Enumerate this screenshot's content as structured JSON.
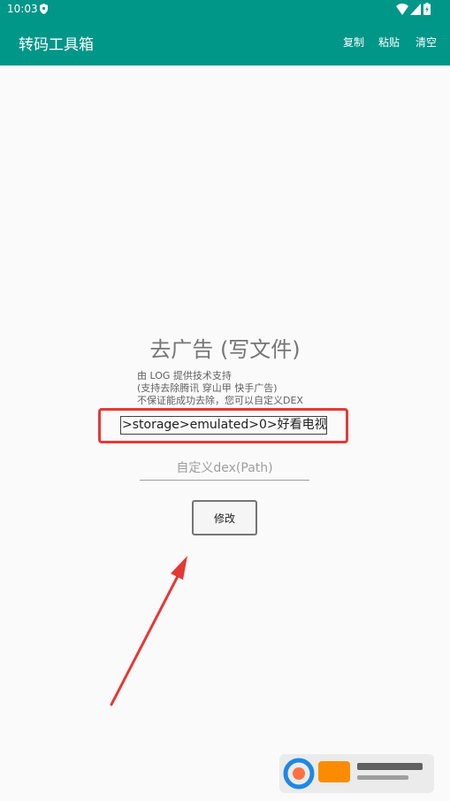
{
  "status_bar": {
    "time": "10:03",
    "icons": [
      "shield-icon",
      "wifi-icon",
      "signal-icon",
      "battery-icon"
    ]
  },
  "app_bar": {
    "title": "转码工具箱",
    "actions": {
      "copy": "复制",
      "paste": "粘贴",
      "clear": "清空"
    }
  },
  "main": {
    "title": "去广告 (写文件)",
    "description": [
      "由 LOG 提供技术支持",
      "(支持去除腾讯 穿山甲 快手广告)",
      "不保证能成功去除，您可以自定义DEX"
    ],
    "path_value": ">storage>emulated>0>好看电视",
    "dex_input_placeholder": "自定义dex(Path)",
    "modify_button": "修改"
  },
  "colors": {
    "primary": "#009688",
    "highlight": "#e53935",
    "background": "#fafafa"
  }
}
